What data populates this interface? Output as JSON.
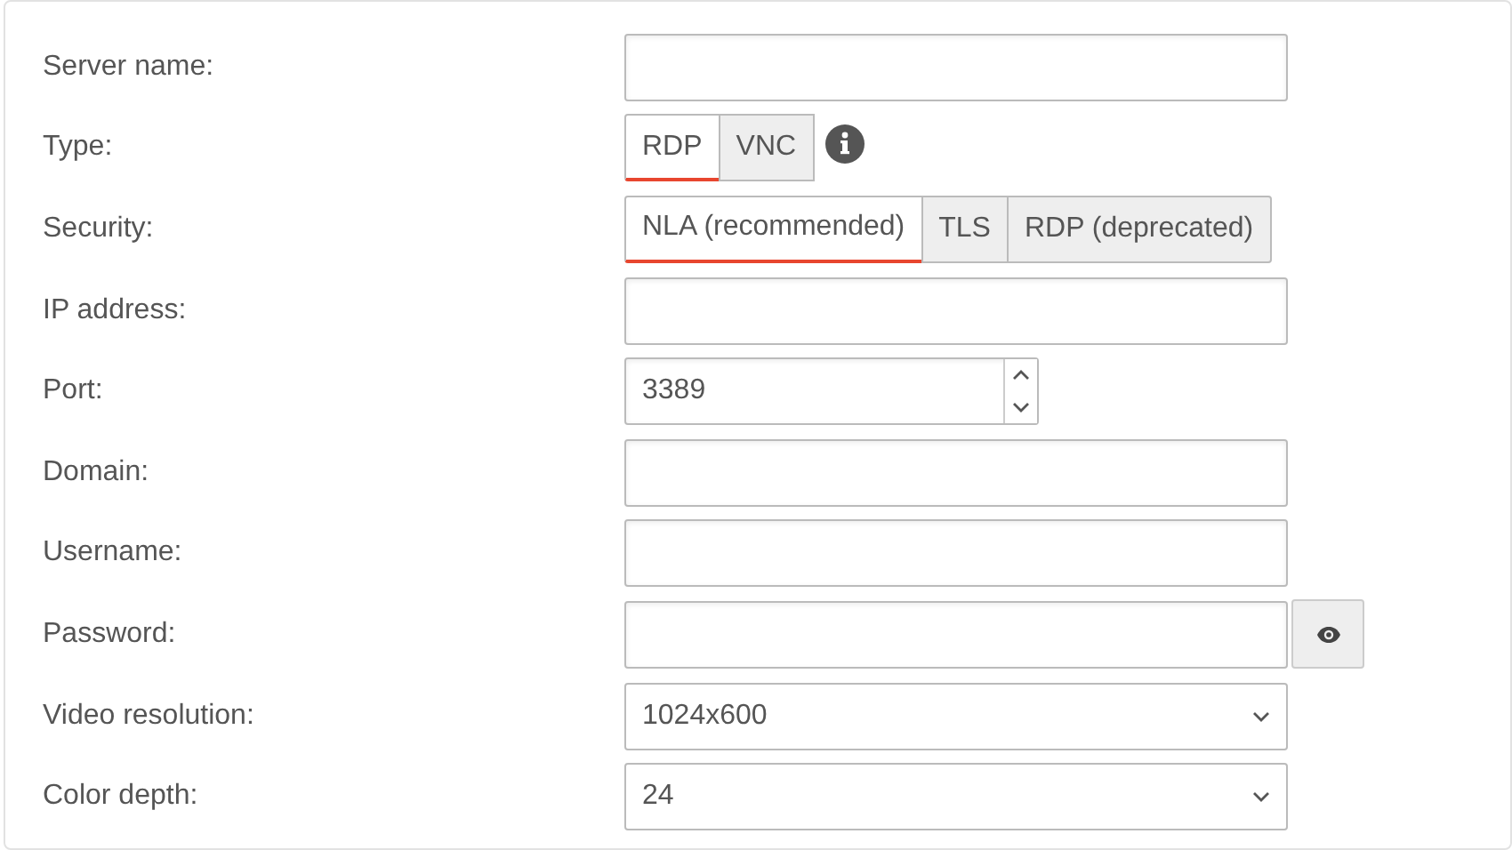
{
  "fields": [
    {
      "kind": "text",
      "label": "Server name:"
    },
    {
      "kind": "toggle",
      "label": "Type:",
      "options": [
        {
          "label": "RDP",
          "selected": true
        },
        {
          "label": "VNC",
          "selected": false
        }
      ],
      "info": true
    },
    {
      "kind": "toggle",
      "label": "Security:",
      "options": [
        {
          "label": "NLA (recommended)",
          "selected": true
        },
        {
          "label": "TLS",
          "selected": false
        },
        {
          "label": "RDP (deprecated)",
          "selected": false
        }
      ]
    },
    {
      "kind": "text",
      "label": "IP address:"
    },
    {
      "kind": "number",
      "label": "Port:",
      "value": "3389"
    },
    {
      "kind": "text",
      "label": "Domain:"
    },
    {
      "kind": "text",
      "label": "Username:"
    },
    {
      "kind": "password",
      "label": "Password:"
    },
    {
      "kind": "select",
      "label": "Video resolution:",
      "value": "1024x600"
    },
    {
      "kind": "select",
      "label": "Color depth:",
      "value": "24"
    }
  ]
}
